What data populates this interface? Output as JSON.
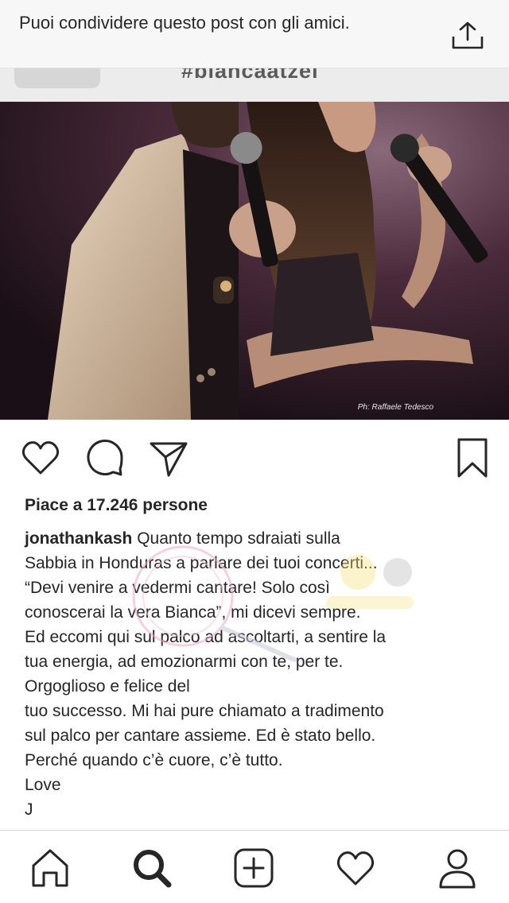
{
  "share_banner": {
    "text": "Puoi condividere questo post con gli amici.",
    "icon": "share-icon"
  },
  "hashtag_strip": {
    "text": "#biancaatzei"
  },
  "photo": {
    "credit": "Ph: Raffaele Tedesco"
  },
  "actions": {
    "like_icon": "heart-icon",
    "comment_icon": "comment-icon",
    "send_icon": "paper-plane-icon",
    "save_icon": "bookmark-icon"
  },
  "post": {
    "likes": "Piace a 17.246 persone",
    "username": "jonathankash",
    "caption_lines": [
      "Quanto tempo sdraiati sulla",
      "Sabbia in Honduras a parlare dei tuoi concerti...",
      "“Devi venire a vedermi cantare! Solo così",
      "conoscerai la vera Bianca”, mi dicevi sempre.",
      "Ed eccomi qui sul palco ad ascoltarti, a sentire la",
      "tua energia, ad emozionarmi con te, per te.",
      "Orgoglioso e felice del",
      "tuo successo. Mi hai pure chiamato a tradimento",
      "sul palco per cantare assieme. Ed è stato bello.",
      "Perché quando c’è cuore, c’è tutto.",
      "Love",
      "J"
    ]
  },
  "tabbar": {
    "items": [
      "home-icon",
      "search-icon",
      "new-post-icon",
      "activity-heart-icon",
      "profile-icon"
    ]
  },
  "colors": {
    "text": "#262626",
    "banner_bg": "#f7f7f7",
    "icon": "#262626"
  }
}
